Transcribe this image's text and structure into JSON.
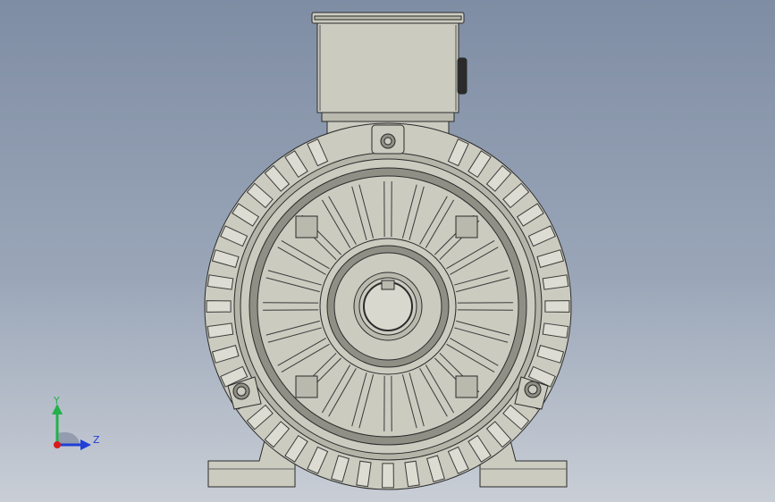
{
  "viewport": {
    "background_top": "#7f8da4",
    "background_bottom": "#c9ced6"
  },
  "model": {
    "body_fill": "#cbcbc0",
    "shade_fill": "#b9b9ad",
    "dark_fill": "#8f8f85",
    "outline": "#2b2b2b"
  },
  "triad": {
    "y_label": "Y",
    "z_label": "Z",
    "y_color": "#22b14c",
    "z_color": "#1f3fd6",
    "x_color": "#d81b1b"
  }
}
